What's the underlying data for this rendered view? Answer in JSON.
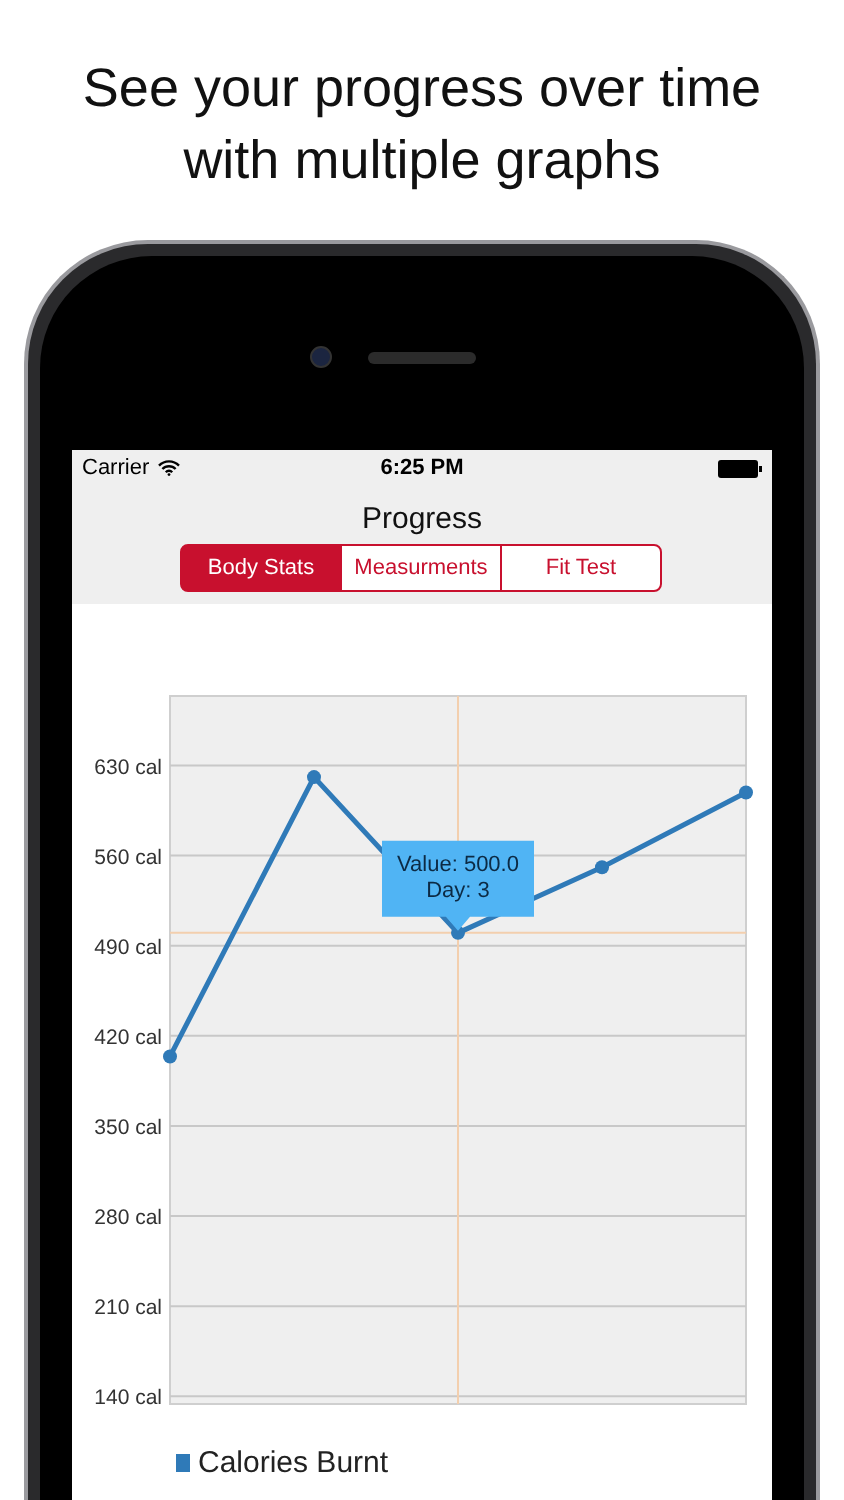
{
  "headline": "See your progress over time with multiple graphs",
  "status_bar": {
    "carrier": "Carrier",
    "time": "6:25 PM"
  },
  "nav": {
    "title": "Progress"
  },
  "segments": [
    {
      "label": "Body Stats",
      "selected": true
    },
    {
      "label": "Measurments",
      "selected": false
    },
    {
      "label": "Fit Test",
      "selected": false
    }
  ],
  "chart": {
    "chart_data": {
      "type": "line",
      "grid": true,
      "ylim": [
        134,
        684
      ],
      "yticks": [
        {
          "value": 140,
          "label": "140 cal"
        },
        {
          "value": 210,
          "label": "210 cal"
        },
        {
          "value": 280,
          "label": "280 cal"
        },
        {
          "value": 350,
          "label": "350 cal"
        },
        {
          "value": 420,
          "label": "420 cal"
        },
        {
          "value": 490,
          "label": "490 cal"
        },
        {
          "value": 560,
          "label": "560 cal"
        },
        {
          "value": 630,
          "label": "630 cal"
        }
      ],
      "series": [
        {
          "name": "Calories Burnt",
          "color": "#2f7ab8",
          "marker": "o",
          "values": [
            404,
            621,
            500,
            551,
            609
          ]
        }
      ],
      "ref_lines": [
        {
          "axis": "y",
          "value": 500
        }
      ],
      "annotations": [
        "Value: 500.0\nDay: 3"
      ]
    }
  }
}
